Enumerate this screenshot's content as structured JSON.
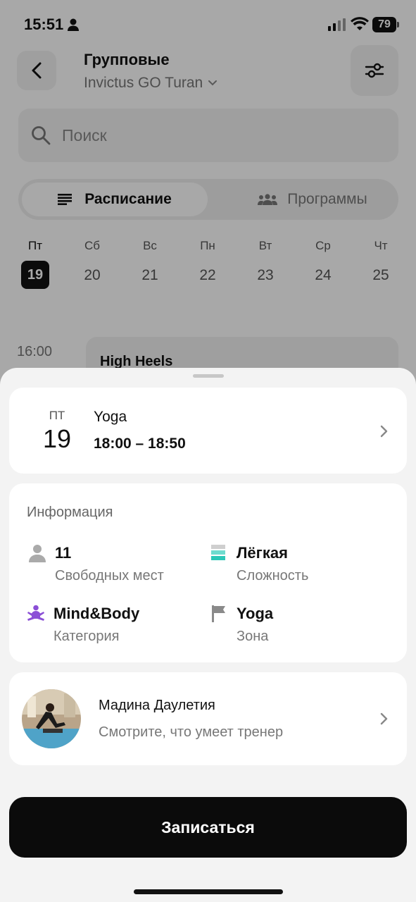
{
  "status": {
    "time": "15:51",
    "battery": "79"
  },
  "header": {
    "title": "Групповые",
    "location": "Invictus GO Turan"
  },
  "search": {
    "placeholder": "Поиск"
  },
  "tabs": [
    {
      "label": "Расписание",
      "active": true
    },
    {
      "label": "Программы",
      "active": false
    }
  ],
  "days": [
    {
      "name": "Пт",
      "num": "19",
      "selected": true
    },
    {
      "name": "Сб",
      "num": "20"
    },
    {
      "name": "Вс",
      "num": "21"
    },
    {
      "name": "Пн",
      "num": "22"
    },
    {
      "name": "Вт",
      "num": "23"
    },
    {
      "name": "Ср",
      "num": "24"
    },
    {
      "name": "Чт",
      "num": "25"
    }
  ],
  "schedule": {
    "time": "16:00",
    "title": "High Heels"
  },
  "sheet": {
    "class": {
      "dow": "ПТ",
      "date": "19",
      "name": "Yoga",
      "time": "18:00 – 18:50"
    },
    "info": {
      "title": "Информация",
      "items": [
        {
          "value": "11",
          "label": "Свободных мест",
          "icon": "person-icon"
        },
        {
          "value": "Лёгкая",
          "label": "Сложность",
          "icon": "difficulty-icon"
        },
        {
          "value": "Mind&Body",
          "label": "Категория",
          "icon": "meditation-icon"
        },
        {
          "value": "Yoga",
          "label": "Зона",
          "icon": "flag-icon"
        }
      ]
    },
    "trainer": {
      "name": "Мадина Даулетия",
      "subtitle": "Смотрите, что умеет тренер"
    },
    "cta": "Записаться"
  },
  "colors": {
    "accent_purple": "#8b4fd6",
    "accent_teal": "#2cc8b8",
    "dark": "#0b0b0b"
  }
}
